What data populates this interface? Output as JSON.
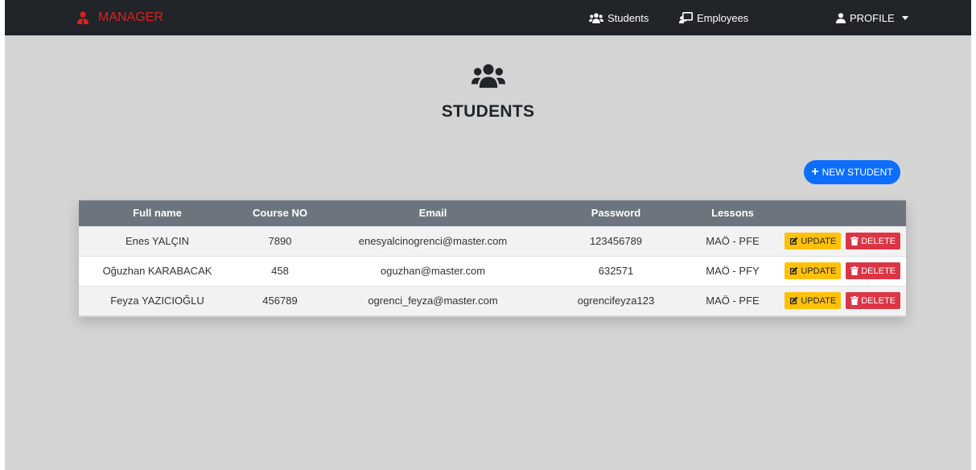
{
  "navbar": {
    "brand": "MANAGER",
    "links": [
      {
        "label": "Students",
        "icon": "users-icon"
      },
      {
        "label": "Employees",
        "icon": "chalkboard-teacher-icon"
      }
    ],
    "profile_label": "PROFILE"
  },
  "header": {
    "icon": "users-icon",
    "title": "STUDENTS"
  },
  "new_button_label": "NEW STUDENT",
  "table": {
    "columns": [
      "Full name",
      "Course NO",
      "Email",
      "Password",
      "Lessons",
      ""
    ],
    "rows": [
      {
        "full_name": "Enes YALÇIN",
        "course_no": "7890",
        "email": "enesyalcinogrenci@master.com",
        "password": "123456789",
        "lessons": "MAÖ - PFE"
      },
      {
        "full_name": "Oğuzhan KARABACAK",
        "course_no": "458",
        "email": "oguzhan@master.com",
        "password": "632571",
        "lessons": "MAÖ - PFY"
      },
      {
        "full_name": "Feyza YAZICIOĞLU",
        "course_no": "456789",
        "email": "ogrenci_feyza@master.com",
        "password": "ogrencifeyza123",
        "lessons": "MAÖ - PFE"
      }
    ],
    "update_label": "UPDATE",
    "delete_label": "DELETE"
  },
  "colors": {
    "navbar": "#212529",
    "brand": "#e01f1f",
    "primary": "#0d6efd",
    "warning": "#ffc107",
    "danger": "#dc3545",
    "table_header": "#6c757d",
    "background": "#d4d4d4"
  }
}
